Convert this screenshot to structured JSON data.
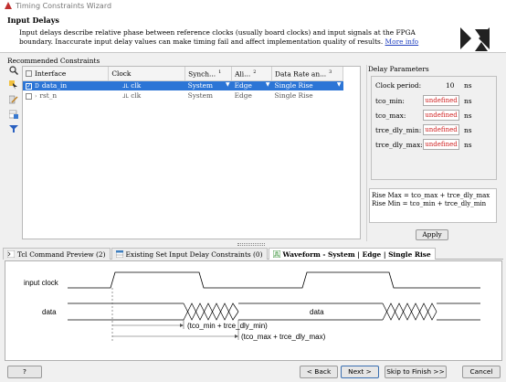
{
  "window": {
    "title": "Timing Constraints Wizard"
  },
  "header": {
    "title": "Input Delays",
    "description": "Input delays describe relative phase between reference clocks (usually board clocks) and input signals at the FPGA boundary. Inaccurate input delay values can make timing fail and affect implementation quality of results.",
    "more_info": "More info"
  },
  "constraints": {
    "label": "Recommended Constraints",
    "columns": [
      "Interface",
      "Clock",
      "Synch...",
      "Ali...",
      "Data Rate an..."
    ],
    "column_sort": [
      "",
      "",
      "1",
      "2",
      "3"
    ],
    "rows": [
      {
        "interface": "data_in",
        "clock": "clk",
        "sync": "System",
        "align": "Edge",
        "rate": "Single Rise",
        "checked": true,
        "selected": true
      },
      {
        "interface": "rst_n",
        "clock": "clk",
        "sync": "System",
        "align": "Edge",
        "rate": "Single Rise",
        "checked": false,
        "selected": false
      }
    ]
  },
  "delay_params": {
    "title": "Delay Parameters",
    "clock_period_label": "Clock period:",
    "clock_period_value": "10",
    "clock_period_unit": "ns",
    "params": [
      {
        "label": "tco_min:",
        "value": "undefined",
        "unit": "ns"
      },
      {
        "label": "tco_max:",
        "value": "undefined",
        "unit": "ns"
      },
      {
        "label": "trce_dly_min:",
        "value": "undefined",
        "unit": "ns"
      },
      {
        "label": "trce_dly_max:",
        "value": "undefined",
        "unit": "ns"
      }
    ],
    "formula_1": "Rise Max = tco_max + trce_dly_max",
    "formula_2": "Rise Min = tco_min + trce_dly_min",
    "apply": "Apply"
  },
  "tabs": [
    {
      "label": "Tcl Command Preview (2)",
      "active": false
    },
    {
      "label": "Existing Set Input Delay Constraints (0)",
      "active": false
    },
    {
      "label": "Waveform - System | Edge | Single Rise",
      "active": true
    }
  ],
  "waveform": {
    "input_clock_label": "input clock",
    "data_label": "data",
    "data_value": "data",
    "min_annotation": "(tco_min + trce_dly_min)",
    "max_annotation": "(tco_max + trce_dly_max)"
  },
  "buttons": {
    "help": "?",
    "back": "< Back",
    "next": "Next >",
    "skip": "Skip to Finish >>",
    "cancel": "Cancel"
  },
  "colors": {
    "selection": "#2c75d6",
    "undefined_text": "#d02020",
    "logo": "#2a2a2a"
  }
}
